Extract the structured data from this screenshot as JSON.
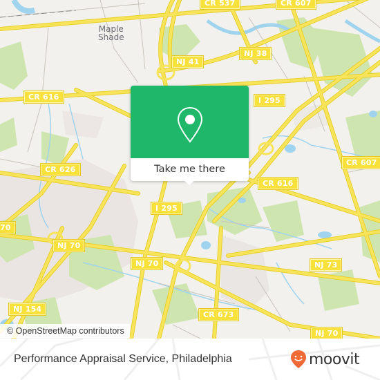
{
  "map": {
    "colors": {
      "background": "#f2f1ed",
      "park": "#cfe5b0",
      "water": "#9fd3ee",
      "road": "#f7e13a",
      "road_edge": "#e8cf2a",
      "urban": "#e7e1de",
      "minor_road": "#c8c4bc"
    },
    "place_labels": [
      {
        "name": "Maple Shade"
      }
    ],
    "road_labels": [
      {
        "id": "cr537",
        "text": "CR 537"
      },
      {
        "id": "cr607-top",
        "text": "CR 607"
      },
      {
        "id": "nj38",
        "text": "NJ 38"
      },
      {
        "id": "nj41",
        "text": "NJ 41"
      },
      {
        "id": "cr616-left",
        "text": "CR 616"
      },
      {
        "id": "i295-top",
        "text": "I 295"
      },
      {
        "id": "cr626",
        "text": "CR 626"
      },
      {
        "id": "cr607-right",
        "text": "CR 607"
      },
      {
        "id": "cr616-right",
        "text": "CR 616"
      },
      {
        "id": "i295-mid",
        "text": "I 295"
      },
      {
        "id": "nj70-left",
        "text": "70"
      },
      {
        "id": "nj70-a",
        "text": "NJ 70"
      },
      {
        "id": "nj70-b",
        "text": "NJ 70"
      },
      {
        "id": "nj73",
        "text": "NJ 73"
      },
      {
        "id": "nj154",
        "text": "NJ 154"
      },
      {
        "id": "cr673",
        "text": "CR 673"
      },
      {
        "id": "nj70-c",
        "text": "NJ 70"
      }
    ],
    "attribution": "© OpenStreetMap contributors"
  },
  "popup": {
    "icon": "map-pin-icon",
    "button_label": "Take me there",
    "color": "#1fb86a"
  },
  "footer": {
    "place_title": "Performance Appraisal Service, Philadelphia",
    "logo_text": "moovit",
    "logo_icon": "moovit-smiley-pin-icon",
    "logo_color": "#f06a35"
  }
}
